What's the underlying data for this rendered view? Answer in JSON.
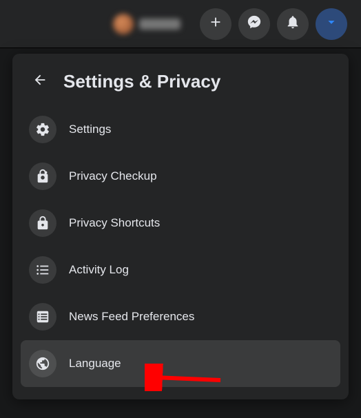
{
  "topbar": {
    "buttons": {
      "create": "plus-icon",
      "messenger": "messenger-icon",
      "notifications": "bell-icon",
      "account": "caret-down-icon"
    }
  },
  "panel": {
    "title": "Settings & Privacy",
    "items": [
      {
        "label": "Settings",
        "icon": "gear-icon",
        "highlighted": false
      },
      {
        "label": "Privacy Checkup",
        "icon": "lock-heart-icon",
        "highlighted": false
      },
      {
        "label": "Privacy Shortcuts",
        "icon": "lock-icon",
        "highlighted": false
      },
      {
        "label": "Activity Log",
        "icon": "list-icon",
        "highlighted": false
      },
      {
        "label": "News Feed Preferences",
        "icon": "feed-icon",
        "highlighted": false
      },
      {
        "label": "Language",
        "icon": "globe-icon",
        "highlighted": true
      }
    ]
  }
}
